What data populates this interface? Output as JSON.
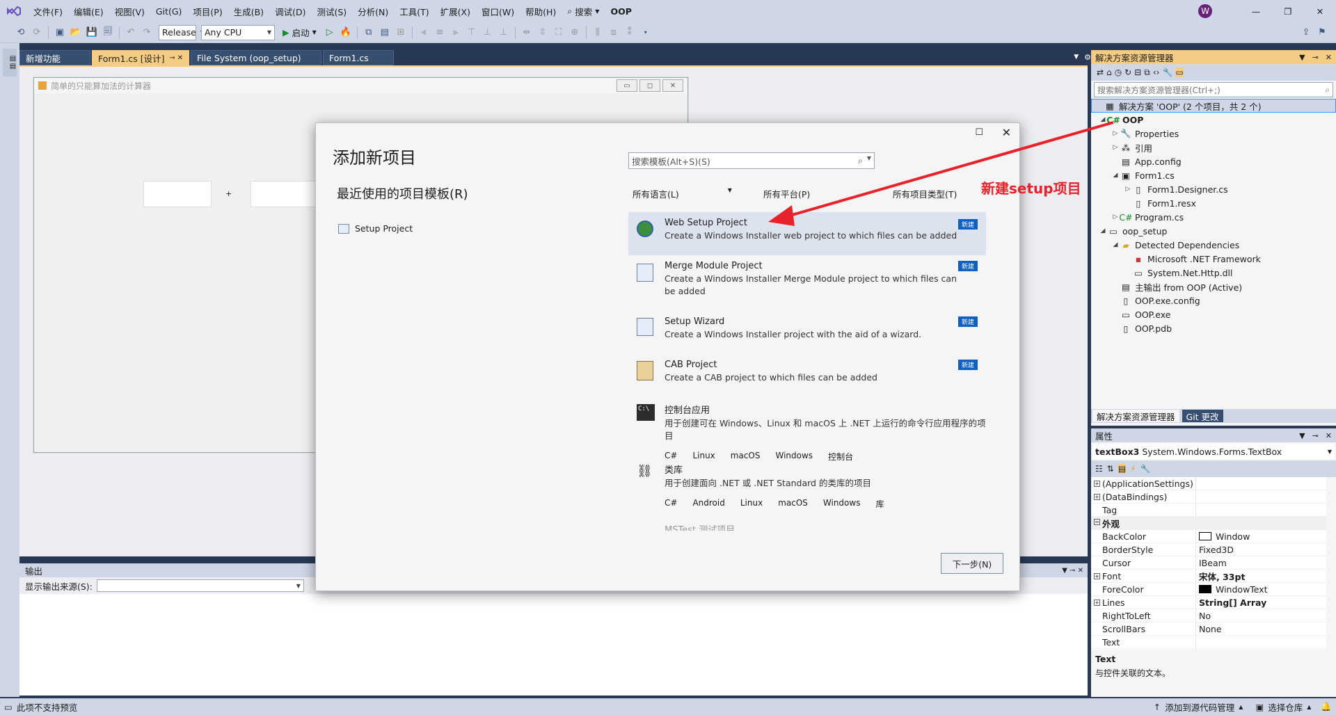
{
  "menu": {
    "items": [
      "文件(F)",
      "编辑(E)",
      "视图(V)",
      "Git(G)",
      "项目(P)",
      "生成(B)",
      "调试(D)",
      "测试(S)",
      "分析(N)",
      "工具(T)",
      "扩展(X)",
      "窗口(W)",
      "帮助(H)"
    ],
    "search_label": "搜索",
    "solution_name": "OOP",
    "avatar_letter": "W"
  },
  "toolbar": {
    "config": "Release",
    "platform": "Any CPU",
    "start_label": "启动"
  },
  "tabs": {
    "new_features": "新增功能",
    "form_designer": "Form1.cs [设计]",
    "file_system": "File System (oop_setup)",
    "form_cs": "Form1.cs"
  },
  "designer": {
    "form_title": "简单的只能算加法的计算器",
    "plus": "+"
  },
  "dialog": {
    "title": "添加新项目",
    "recent_header": "最近使用的项目模板(R)",
    "recent_items": [
      "Setup Project"
    ],
    "search_placeholder": "搜索模板(Alt+S)(S)",
    "filter_language": "所有语言(L)",
    "filter_platform": "所有平台(P)",
    "filter_type": "所有项目类型(T)",
    "new_badge": "新建",
    "templates": [
      {
        "name": "Web Setup Project",
        "desc": "Create a Windows Installer web project to which files can be added"
      },
      {
        "name": "Merge Module Project",
        "desc": "Create a Windows Installer Merge Module project to which files can be added"
      },
      {
        "name": "Setup Wizard",
        "desc": "Create a Windows Installer project with the aid of a wizard."
      },
      {
        "name": "CAB Project",
        "desc": "Create a CAB project to which files can be added"
      },
      {
        "name": "控制台应用",
        "desc": "用于创建可在 Windows、Linux 和 macOS 上 .NET 上运行的命令行应用程序的项目",
        "tags": [
          "C#",
          "Linux",
          "macOS",
          "Windows",
          "控制台"
        ]
      },
      {
        "name": "类库",
        "desc": "用于创建面向 .NET 或 .NET Standard 的类库的项目",
        "tags": [
          "C#",
          "Android",
          "Linux",
          "macOS",
          "Windows",
          "库"
        ]
      },
      {
        "name": "MSTest 测试项目"
      }
    ],
    "next_button": "下一步(N)"
  },
  "annotation": {
    "text": "新建setup项目",
    "color": "#e8222a"
  },
  "output": {
    "title": "输出",
    "source_label": "显示输出来源(S):"
  },
  "solution_explorer": {
    "title": "解决方案资源管理器",
    "search_placeholder": "搜索解决方案资源管理器(Ctrl+;)",
    "items": [
      "解决方案 'OOP' (2 个项目，共 2 个)",
      "OOP",
      "Properties",
      "引用",
      "App.config",
      "Form1.cs",
      "Form1.Designer.cs",
      "Form1.resx",
      "Program.cs",
      "oop_setup",
      "Detected Dependencies",
      "Microsoft .NET Framework",
      "System.Net.Http.dll",
      "主输出 from OOP (Active)",
      "OOP.exe.config",
      "OOP.exe",
      "OOP.pdb"
    ],
    "tab_solution": "解决方案资源管理器",
    "tab_git": "Git 更改"
  },
  "properties": {
    "title": "属性",
    "object_name": "textBox3",
    "object_type": "System.Windows.Forms.TextBox",
    "rows": [
      {
        "k": "(ApplicationSettings)",
        "v": ""
      },
      {
        "k": "(DataBindings)",
        "v": ""
      },
      {
        "k": "Tag",
        "v": ""
      },
      {
        "k": "外观",
        "v": ""
      },
      {
        "k": "BackColor",
        "v": "Window"
      },
      {
        "k": "BorderStyle",
        "v": "Fixed3D"
      },
      {
        "k": "Cursor",
        "v": "IBeam"
      },
      {
        "k": "Font",
        "v": "宋体, 33pt"
      },
      {
        "k": "ForeColor",
        "v": "WindowText"
      },
      {
        "k": "Lines",
        "v": "String[] Array"
      },
      {
        "k": "RightToLeft",
        "v": "No"
      },
      {
        "k": "ScrollBars",
        "v": "None"
      },
      {
        "k": "Text",
        "v": ""
      }
    ],
    "desc_title": "Text",
    "desc_text": "与控件关联的文本。"
  },
  "status": {
    "left": "此项不支持预览",
    "add_source": "添加到源代码管理",
    "select_repo": "选择仓库"
  }
}
